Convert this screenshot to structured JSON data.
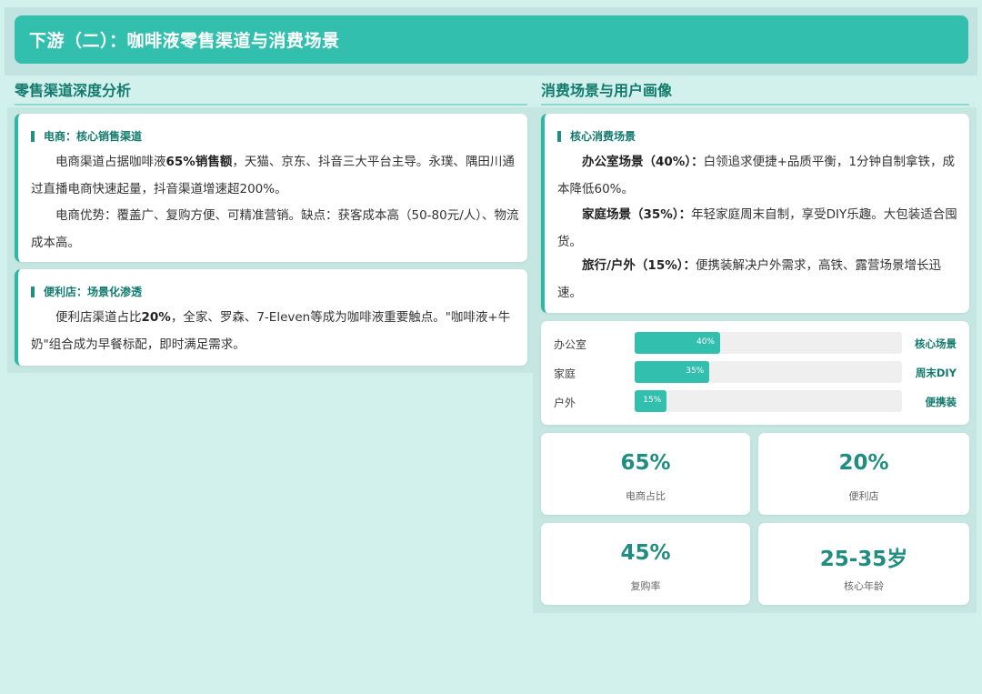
{
  "header": {
    "title": "下游（二）：咖啡液零售渠道与消费场景"
  },
  "left": {
    "title": "零售渠道深度分析",
    "card1": {
      "heading": "电商：核心销售渠道",
      "p1_pre": "电商渠道占据咖啡液",
      "p1_bold": "65%销售额",
      "p1_post": "，天猫、京东、抖音三大平台主导。永璞、隅田川通过直播电商快速起量，抖音渠道增速超200%。",
      "p2": "电商优势：覆盖广、复购方便、可精准营销。缺点：获客成本高（50-80元/人）、物流成本高。"
    },
    "card2": {
      "heading": "便利店：场景化渗透",
      "p1_pre": "便利店渠道占比",
      "p1_bold": "20%",
      "p1_post": "，全家、罗森、7-Eleven等成为咖啡液重要触点。\"咖啡液+牛奶\"组合成为早餐标配，即时满足需求。"
    }
  },
  "right": {
    "title": "消费场景与用户画像",
    "card": {
      "heading": "核心消费场景",
      "items": [
        {
          "bold": "办公室场景（40%）：",
          "text": "白领追求便捷+品质平衡，1分钟自制拿铁，成本降低60%。"
        },
        {
          "bold": "家庭场景（35%）：",
          "text": "年轻家庭周末自制，享受DIY乐趣。大包装适合囤货。"
        },
        {
          "bold": "旅行/户外（15%）：",
          "text": "便携装解决户外需求，高铁、露营场景增长迅速。"
        }
      ]
    },
    "bars": [
      {
        "label": "办公室",
        "value": 40,
        "display": "40%",
        "tag": "核心场景"
      },
      {
        "label": "家庭",
        "value": 35,
        "display": "35%",
        "tag": "周末DIY"
      },
      {
        "label": "户外",
        "value": 15,
        "display": "15%",
        "tag": "便携装"
      }
    ],
    "stats": [
      {
        "value": "65%",
        "label": "电商占比"
      },
      {
        "value": "20%",
        "label": "便利店"
      },
      {
        "value": "45%",
        "label": "复购率"
      },
      {
        "value": "25-35岁",
        "label": "核心年龄"
      }
    ]
  },
  "colors": {
    "accent": "#32bfae",
    "accent_dark": "#137a6e",
    "background": "#d3f1ec"
  }
}
